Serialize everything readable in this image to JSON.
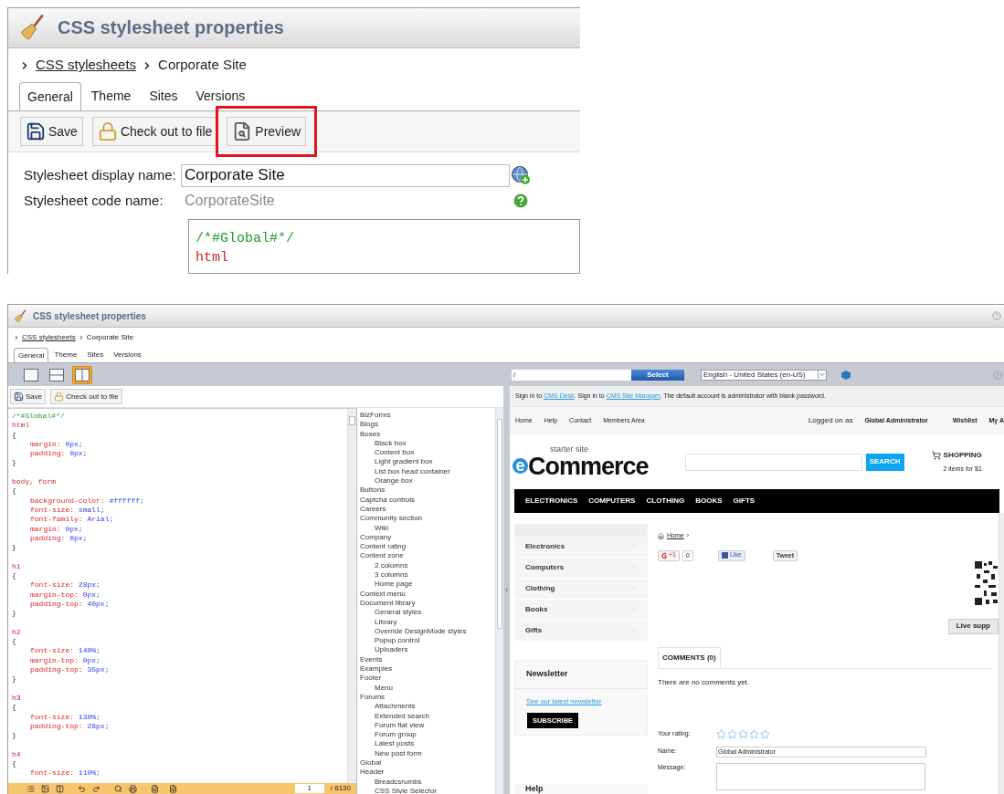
{
  "top": {
    "title": "CSS stylesheet properties",
    "breadcrumb": {
      "parent": "CSS stylesheets",
      "current": "Corporate Site"
    },
    "tabs": [
      {
        "label": "General",
        "selected": true
      },
      {
        "label": "Theme",
        "selected": false
      },
      {
        "label": "Sites",
        "selected": false
      },
      {
        "label": "Versions",
        "selected": false
      }
    ],
    "buttons": [
      {
        "label": "Save",
        "kind": "save",
        "highlighted": false
      },
      {
        "label": "Check out to file",
        "kind": "lock",
        "highlighted": false
      },
      {
        "label": "Preview",
        "kind": "preview",
        "highlighted": true
      }
    ],
    "display_name": {
      "label": "Stylesheet display name:",
      "value": "Corporate Site"
    },
    "code_name": {
      "label": "Stylesheet code name:",
      "value": "CorporateSite"
    },
    "code_lines": [
      {
        "kind": "comment",
        "text": "/*#Global#*/"
      },
      {
        "kind": "selector",
        "text": "html"
      }
    ]
  },
  "bottom": {
    "title": "CSS stylesheet properties",
    "breadcrumb": {
      "parent": "CSS stylesheets",
      "current": "Corporate Site"
    },
    "tabs": [
      {
        "label": "General",
        "selected": true
      },
      {
        "label": "Theme",
        "selected": false
      },
      {
        "label": "Sites",
        "selected": false
      },
      {
        "label": "Versions",
        "selected": false
      }
    ],
    "layouts": [
      {
        "kind": "single",
        "selected": false
      },
      {
        "kind": "horizontal",
        "selected": false
      },
      {
        "kind": "vertical",
        "selected": true
      }
    ],
    "buttons": [
      {
        "label": "Save",
        "kind": "save",
        "highlighted": false
      },
      {
        "label": "Check out to file",
        "kind": "lock",
        "highlighted": false
      }
    ],
    "code_lines": [
      {
        "kind": "comment",
        "text": "/*#Global#*/"
      },
      {
        "kind": "selector",
        "text": "html"
      },
      {
        "kind": "brace",
        "text": "{"
      },
      {
        "kind": "prop",
        "prop": "margin:",
        "value": "0px;"
      },
      {
        "kind": "prop",
        "prop": "padding:",
        "value": "0px;"
      },
      {
        "kind": "brace",
        "text": "}"
      },
      {
        "kind": "blank"
      },
      {
        "kind": "selector",
        "text": "body, form"
      },
      {
        "kind": "brace",
        "text": "{"
      },
      {
        "kind": "prop",
        "prop": "background-color:",
        "value": "#ffffff;"
      },
      {
        "kind": "prop",
        "prop": "font-size:",
        "value": "small;"
      },
      {
        "kind": "prop",
        "prop": "font-family:",
        "value": "Arial;"
      },
      {
        "kind": "prop",
        "prop": "margin:",
        "value": "0px;"
      },
      {
        "kind": "prop",
        "prop": "padding:",
        "value": "0px;"
      },
      {
        "kind": "brace",
        "text": "}"
      },
      {
        "kind": "blank"
      },
      {
        "kind": "selector",
        "text": "h1"
      },
      {
        "kind": "brace",
        "text": "{"
      },
      {
        "kind": "prop",
        "prop": "font-size:",
        "value": "28px;"
      },
      {
        "kind": "prop",
        "prop": "margin-top:",
        "value": "0px;"
      },
      {
        "kind": "prop",
        "prop": "padding-top:",
        "value": "40px;"
      },
      {
        "kind": "brace",
        "text": "}"
      },
      {
        "kind": "blank"
      },
      {
        "kind": "selector",
        "text": "h2"
      },
      {
        "kind": "brace",
        "text": "{"
      },
      {
        "kind": "prop",
        "prop": "font-size:",
        "value": "140%;"
      },
      {
        "kind": "prop",
        "prop": "margin-top:",
        "value": "0px;"
      },
      {
        "kind": "prop",
        "prop": "padding-top:",
        "value": "35px;"
      },
      {
        "kind": "brace",
        "text": "}"
      },
      {
        "kind": "blank"
      },
      {
        "kind": "selector",
        "text": "h3"
      },
      {
        "kind": "brace",
        "text": "{"
      },
      {
        "kind": "prop",
        "prop": "font-size:",
        "value": "130%;"
      },
      {
        "kind": "prop",
        "prop": "padding-top:",
        "value": "28px;"
      },
      {
        "kind": "brace",
        "text": "}"
      },
      {
        "kind": "blank"
      },
      {
        "kind": "selector",
        "text": "h4"
      },
      {
        "kind": "brace",
        "text": "{"
      },
      {
        "kind": "prop",
        "prop": "font-size:",
        "value": "110%;"
      }
    ],
    "status": {
      "page": "1",
      "total": "/ 6130"
    },
    "style_tree": [
      {
        "label": "BizForms"
      },
      {
        "label": "Blogs"
      },
      {
        "label": "Boxes",
        "children": [
          {
            "label": "Black box"
          },
          {
            "label": "Content box"
          },
          {
            "label": "Light gradient box"
          },
          {
            "label": "List box head container"
          },
          {
            "label": "Orange box"
          }
        ]
      },
      {
        "label": "Buttons"
      },
      {
        "label": "Captcha controls"
      },
      {
        "label": "Careers"
      },
      {
        "label": "Community section",
        "children": [
          {
            "label": "Wiki"
          }
        ]
      },
      {
        "label": "Company"
      },
      {
        "label": "Content rating"
      },
      {
        "label": "Content zone",
        "children": [
          {
            "label": "2 columns"
          },
          {
            "label": "3 columns"
          },
          {
            "label": "Home page"
          }
        ]
      },
      {
        "label": "Context menu"
      },
      {
        "label": "Document library",
        "children": [
          {
            "label": "General styles"
          },
          {
            "label": "Library"
          },
          {
            "label": "Override DesignMode styles"
          },
          {
            "label": "Popup control"
          },
          {
            "label": "Uploaders"
          }
        ]
      },
      {
        "label": "Events"
      },
      {
        "label": "Examples"
      },
      {
        "label": "Footer",
        "children": [
          {
            "label": "Menu"
          }
        ]
      },
      {
        "label": "Forums",
        "children": [
          {
            "label": "Attachments"
          },
          {
            "label": "Extended search"
          },
          {
            "label": "Forum flat view"
          },
          {
            "label": "Forum group"
          },
          {
            "label": "Latest posts"
          },
          {
            "label": "New post form"
          }
        ]
      },
      {
        "label": "Global"
      },
      {
        "label": "Header",
        "children": [
          {
            "label": "Breadcsrumbs"
          },
          {
            "label": "CSS Style Selector"
          }
        ]
      }
    ],
    "preview": {
      "path": "/",
      "select": "Select",
      "language": "English - United States (en-US)",
      "signin": [
        {
          "text": "Sign in to ",
          "link": false
        },
        {
          "text": "CMS Desk",
          "link": true
        },
        {
          "text": ". Sign in to ",
          "link": false
        },
        {
          "text": "CMS Site Manager",
          "link": true
        },
        {
          "text": ". The default account is administrator with blank password.",
          "link": false
        }
      ],
      "top_nav": [
        "Home",
        "Help",
        "Contact",
        "Members Area"
      ],
      "logged_on": "Logged on as",
      "user": "Global Administrator",
      "account_links": [
        "Wishlist",
        "My A"
      ],
      "logo": {
        "tagline": "starter site",
        "mark": "e",
        "name": "Commerce"
      },
      "search_button": "SEARCH",
      "cart": {
        "title": "SHOPPING",
        "summary": "2 items for $1"
      },
      "categories": [
        "ELECTRONICS",
        "COMPUTERS",
        "CLOTHING",
        "BOOKS",
        "GIFTS"
      ],
      "side_menu": [
        "Electronics",
        "Computers",
        "Clothing",
        "Books",
        "Gifts"
      ],
      "newsletter": {
        "title": "Newsletter",
        "link": "See our latest newsletter",
        "button": "SUBSCRIBE"
      },
      "help_title": "Help",
      "crumb": {
        "home": "Home",
        "separator": "›"
      },
      "social": {
        "plus": "+1",
        "count": "0",
        "like": "Like",
        "tweet": "Tweet"
      },
      "live_support": "Live supp",
      "comments_tab": "COMMENTS (0)",
      "no_comments": "There are no comments yet.",
      "rating": {
        "label": "Your rating:",
        "stars": 0
      },
      "name": {
        "label": "Name:",
        "value": "Global Administrator"
      },
      "message": {
        "label": "Message:"
      }
    }
  }
}
